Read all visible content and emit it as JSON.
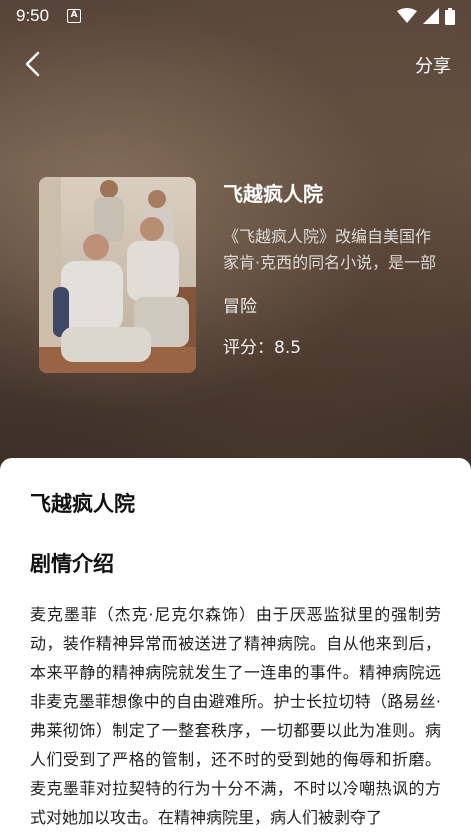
{
  "status_bar": {
    "time": "9:50",
    "notification_icon": "A",
    "icons": [
      "wifi-icon",
      "signal-icon",
      "battery-icon"
    ]
  },
  "nav": {
    "back_icon": "chevron-left-icon",
    "share_label": "分享"
  },
  "movie": {
    "title": "飞越疯人院",
    "desc_line1": "《飞越疯人院》改编自美国作",
    "desc_line2": "家肯·克西的同名小说，是一部",
    "genre": "冒险",
    "score_label": "评分：8.5"
  },
  "detail": {
    "title": "飞越疯人院",
    "section_heading": "剧情介绍",
    "synopsis": "麦克墨菲（杰克·尼克尔森饰）由于厌恶监狱里的强制劳动，装作精神异常而被送进了精神病院。自从他来到后，本来平静的精神病院就发生了一连串的事件。精神病院远非麦克墨菲想像中的自由避难所。护士长拉切特（路易丝·弗莱彻饰）制定了一整套秩序，一切都要以此为准则。病人们受到了严格的管制，还不时的受到她的侮辱和折磨。麦克墨菲对拉契特的行为十分不满，不时以冷嘲热讽的方式对她加以攻击。在精神病院里，病人们被剥夺了"
  },
  "colors": {
    "hero_tint": "#6b5446",
    "text_primary": "#111111",
    "text_body": "#222222",
    "white": "#ffffff"
  }
}
